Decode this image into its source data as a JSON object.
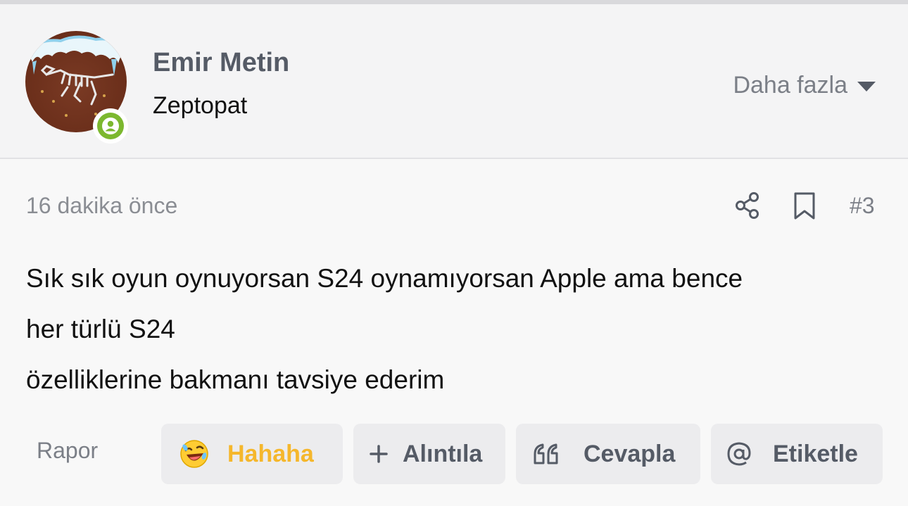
{
  "user": {
    "name": "Emir Metin",
    "title": "Zeptopat"
  },
  "header": {
    "more_label": "Daha fazla"
  },
  "post": {
    "time": "16 dakika önce",
    "number": "#3",
    "lines": [
      "Sık sık oyun oynuyorsan S24 oynamıyorsan Apple ama bence",
      "her türlü S24",
      "özelliklerine bakmanı tavsiye ederim"
    ]
  },
  "actions": {
    "report_label": "Rapor",
    "haha_label": "Hahaha",
    "quote_label": "Alıntıla",
    "reply_label": "Cevapla",
    "tag_label": "Etiketle"
  },
  "colors": {
    "online": "#7cb82f",
    "haha": "#f5b72c",
    "muted_text": "#7b7f87",
    "button_bg": "#ececee"
  },
  "icons": [
    "share-icon",
    "bookmark-icon",
    "chevron-down-icon",
    "laughing-emoji-icon",
    "plus-icon",
    "quote-icon",
    "at-icon",
    "user-icon"
  ]
}
